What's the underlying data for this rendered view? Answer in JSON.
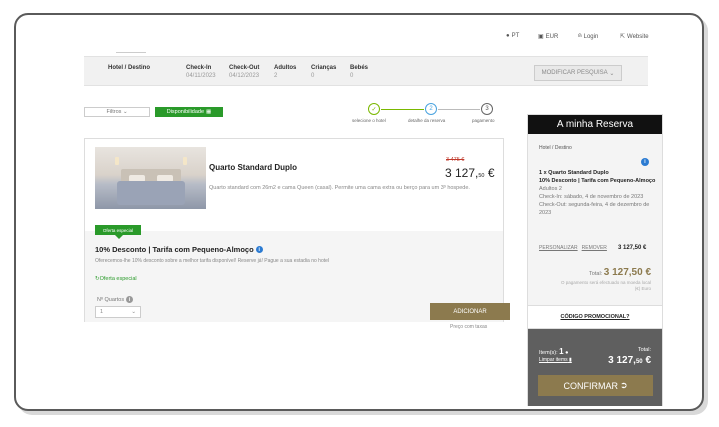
{
  "topbar": {
    "language": "PT",
    "currency": "EUR",
    "login": "Login",
    "website": "Website"
  },
  "summary": {
    "hotel_label": "Hotel / Destino",
    "checkin_label": "Check-In",
    "checkin_value": "04/11/2023",
    "checkout_label": "Check-Out",
    "checkout_value": "04/12/2023",
    "adults_label": "Adultos",
    "adults_value": "2",
    "children_label": "Crianças",
    "children_value": "0",
    "babies_label": "Bebés",
    "babies_value": "0",
    "modify_label": "MODIFICAR PESQUISA"
  },
  "filters": {
    "filters_label": "Filtros",
    "availability_label": "Disponibilidade"
  },
  "steps": {
    "step1_label": "selecione o hotel",
    "step2_num": "2",
    "step2_label": "detalhe da reserva",
    "step3_num": "3",
    "step3_label": "pagamento"
  },
  "room": {
    "title": "Quarto Standard Duplo",
    "description": "Quarto standard com 26m2 e cama Queen (casal). Permite uma cama extra ou berço para um 3º hospede.",
    "badge": "Oferta especial",
    "rate_title": "10% Desconto | Tarifa com Pequeno-Almoço",
    "rate_desc": "Oferecemos-lhe 10% desconto sobre a melhor tarifa disponível! Reserve já! Pague a sua estadia no hotel",
    "special_offer": "Oferta especial",
    "rooms_label": "Nº Quartos",
    "rooms_value": "1",
    "old_price": "3 475 €",
    "new_price_int": "3 127,",
    "new_price_dec": "50",
    "currency_symbol": "€",
    "add_label": "ADICIONAR",
    "taxes_label": "Preço com taxas"
  },
  "reservation": {
    "header": "A minha Reserva",
    "hotel_label": "Hotel / Destino",
    "line_title": "1 x Quarto Standard Duplo",
    "line_rate": "10% Desconto | Tarifa com Pequeno-Almoço",
    "adults": "Adultos 2",
    "checkin": "Check-In: sábado, 4 de novembro de 2023",
    "checkout": "Check-Out: segunda-feira, 4 de dezembro de 2023",
    "customize": "PERSONALIZAR",
    "remove": "REMOVER",
    "line_price": "3 127,50 €",
    "total_label": "Total:",
    "total_value": "3 127,50 €",
    "note": "O pagamento será efectuado na moeda local (€) Euro",
    "promo": "CÓDIGO PROMOCIONAL?",
    "items_label": "Item(s):",
    "items_count": "1",
    "clear_label": "Limpar items",
    "bottom_total_label": "Total:",
    "bottom_total_int": "3 127,",
    "bottom_total_dec": "50",
    "bottom_total_cur": "€",
    "confirm_label": "CONFIRMAR"
  },
  "colors": {
    "green": "#2a9a2a",
    "gold": "#8c7a4e",
    "dark": "#111111",
    "panel_gray": "#5f5f5f"
  }
}
